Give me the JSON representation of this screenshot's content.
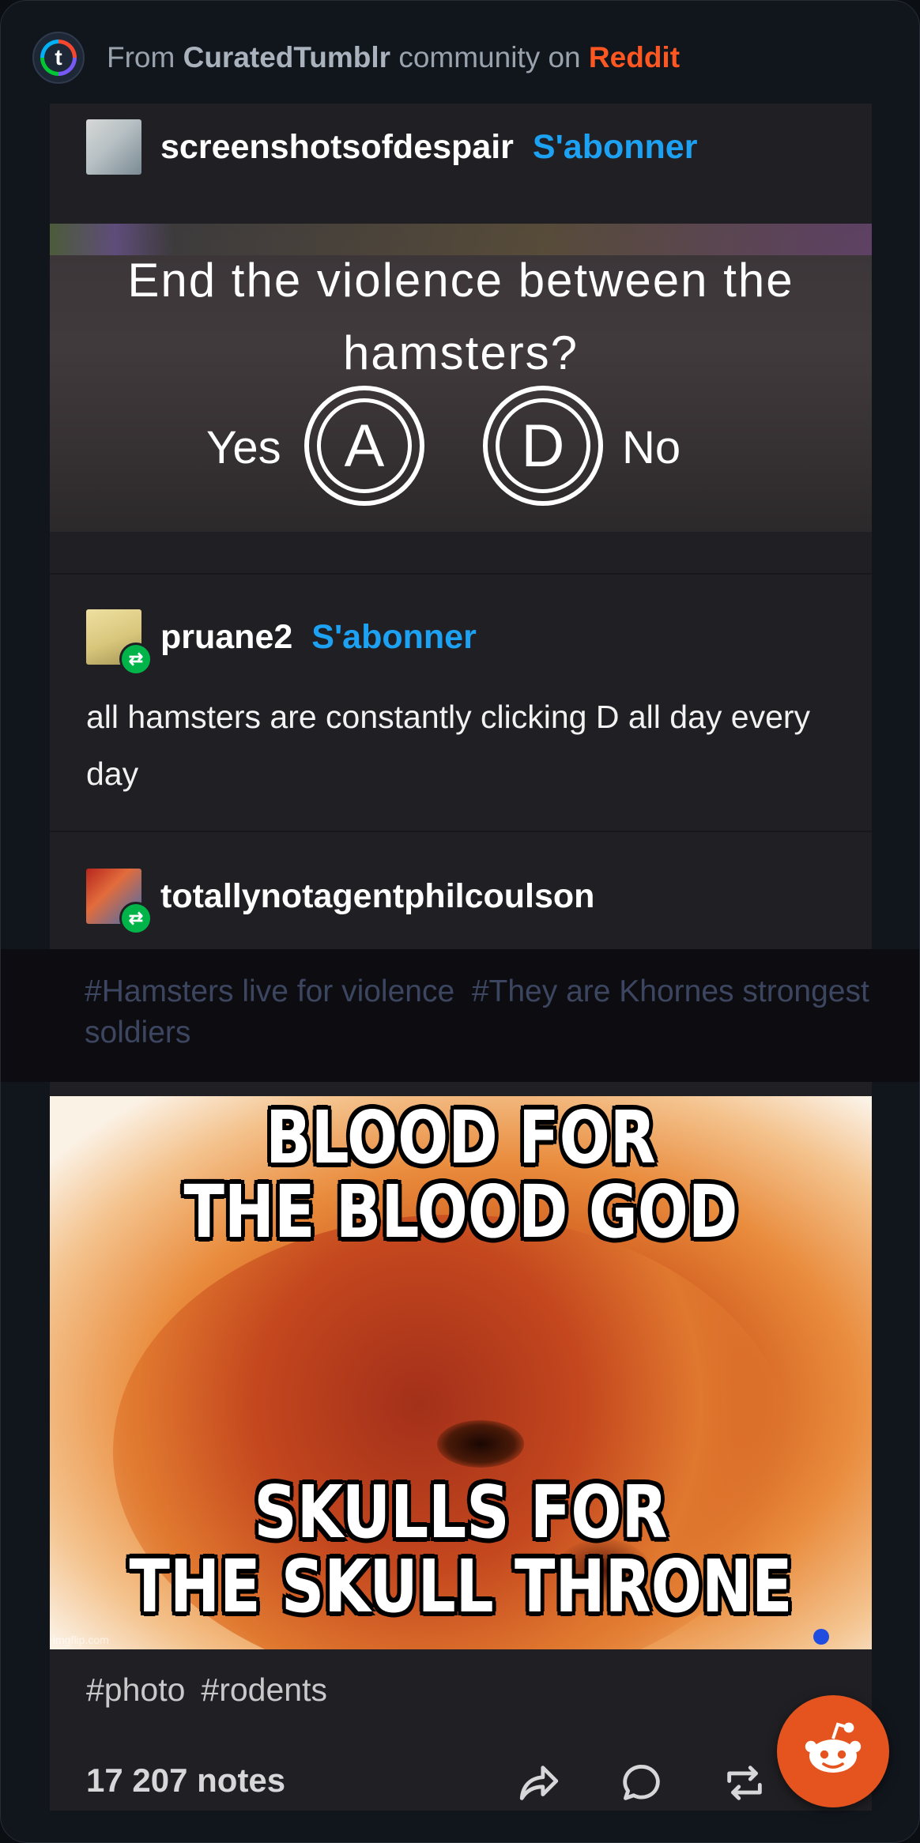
{
  "header": {
    "logo_letter": "t",
    "from_text": "From ",
    "community": "CuratedTumblr",
    "middle_text": " community on ",
    "platform": "Reddit"
  },
  "posts": [
    {
      "username": "screenshotsofdespair",
      "follow_label": "S'abonner"
    },
    {
      "username": "pruane2",
      "follow_label": "S'abonner",
      "text": "all hamsters are constantly clicking D all day every day"
    },
    {
      "username": "totallynotagentphilcoulson"
    }
  ],
  "quiz_image": {
    "question": "End the violence between the hamsters?",
    "option_a_label": "Yes",
    "option_a_key": "A",
    "option_d_key": "D",
    "option_d_label": "No"
  },
  "reblog_tags": [
    "#Hamsters live for violence",
    "#They are Khornes strongest soldiers"
  ],
  "meme_image": {
    "top_text_line1": "BLOOD FOR",
    "top_text_line2": "THE BLOOD GOD",
    "bottom_text_line1": "SKULLS FOR",
    "bottom_text_line2": "THE SKULL THRONE",
    "watermark": "imgflip.com"
  },
  "post_tags": [
    "#photo",
    "#rodents"
  ],
  "footer": {
    "notes": "17 207 notes",
    "actions": [
      "share-icon",
      "reply-icon",
      "reblog-icon",
      "like-icon"
    ]
  },
  "colors": {
    "follow_link": "#1da1f2",
    "reddit_brand": "#ff5722",
    "reblog_badge": "#00b44a",
    "reddit_fab": "#e5541f"
  }
}
